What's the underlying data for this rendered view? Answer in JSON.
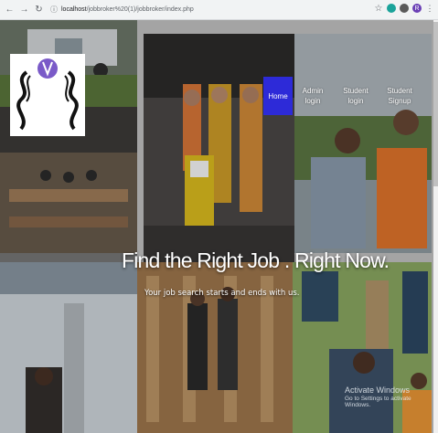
{
  "browser": {
    "back_icon": "arrow-left-icon",
    "forward_icon": "arrow-right-icon",
    "reload_icon": "reload-icon",
    "info_icon": "info-icon",
    "url_host": "localhost",
    "url_path": "/jobbroker%20(1)/jobbroker/index.php",
    "star_icon": "star-icon",
    "profile_initial": "R"
  },
  "nav": {
    "home": "Home",
    "admin_line1": "Admin",
    "admin_line2": "login",
    "student_line1": "Student",
    "student_line2": "login",
    "signup_line1": "Student",
    "signup_line2": "Signup"
  },
  "hero": {
    "title": "Find the Right Job . Right Now.",
    "subtitle": "Your job search starts and ends with us."
  },
  "overlay": {
    "activate_title": "Activate Windows",
    "activate_sub": "Go to Settings to activate Windows."
  },
  "colors": {
    "nav_active": "#2d2ad8",
    "logo_bg": "#ffffff"
  }
}
